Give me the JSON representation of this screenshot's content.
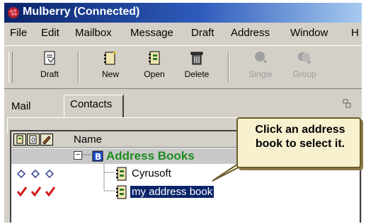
{
  "window": {
    "title": "Mulberry (Connected)"
  },
  "menu": [
    "File",
    "Edit",
    "Mailbox",
    "Message",
    "Draft",
    "Address",
    "Window",
    "H"
  ],
  "toolbar": {
    "draft": "Draft",
    "new": "New",
    "open": "Open",
    "delete": "Delete",
    "single": "Single",
    "group": "Group"
  },
  "tabs": {
    "mail": "Mail",
    "contacts": "Contacts"
  },
  "list": {
    "column_name": "Name",
    "group_label": "Address Books",
    "items": [
      "Cyrusoft",
      "my address book"
    ]
  },
  "callout": {
    "text": "Click an address book to select it."
  },
  "colors": {
    "title_bar": "#0a246a",
    "group_text": "#1e8c1e",
    "selection": "#0a246a",
    "callout_bg": "#f7f1cf"
  }
}
